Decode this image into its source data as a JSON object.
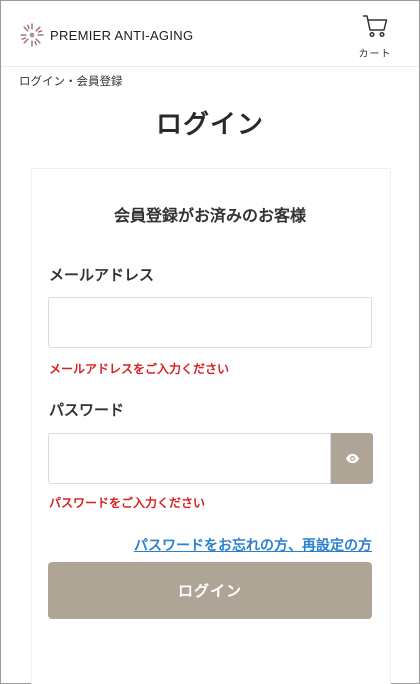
{
  "header": {
    "logo_text": "PREMIER ANTI-AGING",
    "cart_label": "カート"
  },
  "breadcrumb": "ログイン・会員登録",
  "page_title": "ログイン",
  "login_form": {
    "heading": "会員登録がお済みのお客様",
    "email": {
      "label": "メールアドレス",
      "value": "",
      "error": "メールアドレスをご入力ください"
    },
    "password": {
      "label": "パスワード",
      "value": "",
      "error": "パスワードをご入力ください"
    },
    "forgot_link": "パスワードをお忘れの方、再設定の方",
    "submit_label": "ログイン"
  },
  "colors": {
    "accent": "#aea597",
    "error": "#d92020",
    "link": "#2b7fcf"
  },
  "icons": {
    "logo": "flower-logo-icon",
    "cart": "cart-icon",
    "password_toggle": "eye-icon"
  }
}
